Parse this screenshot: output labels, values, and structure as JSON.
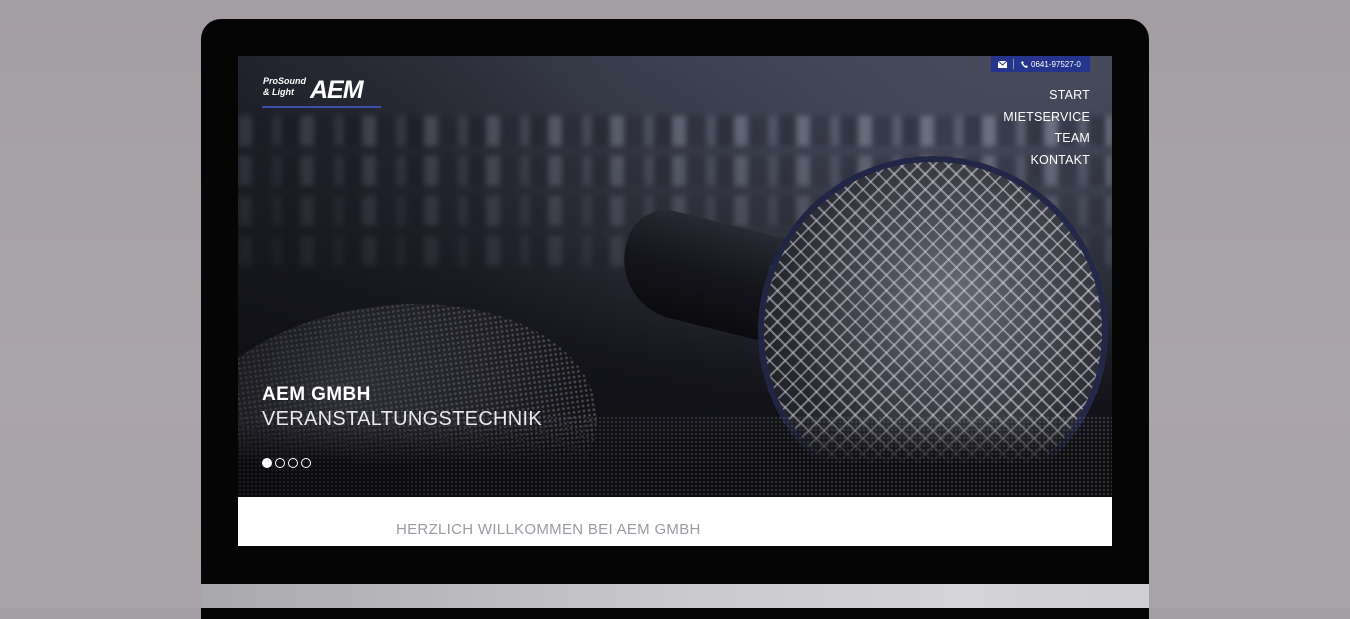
{
  "logo": {
    "line1": "ProSound",
    "line2": "& Light",
    "mark": "AEM"
  },
  "contact": {
    "mail_icon": "mail-icon",
    "phone_icon": "phone-icon",
    "phone": "0641-97527-0"
  },
  "nav": {
    "items": [
      {
        "label": "START"
      },
      {
        "label": "MIETSERVICE"
      },
      {
        "label": "TEAM"
      },
      {
        "label": "KONTAKT"
      }
    ]
  },
  "hero": {
    "title": "AEM GMBH",
    "subtitle": "VERANSTALTUNGSTECHNIK",
    "slide_count": 4,
    "active_slide": 1
  },
  "welcome": {
    "heading": "HERZLICH WILLKOMMEN BEI AEM GMBH"
  },
  "colors": {
    "accent": "#27348b",
    "bezel": "#050505",
    "background": "#a8a3a8"
  }
}
